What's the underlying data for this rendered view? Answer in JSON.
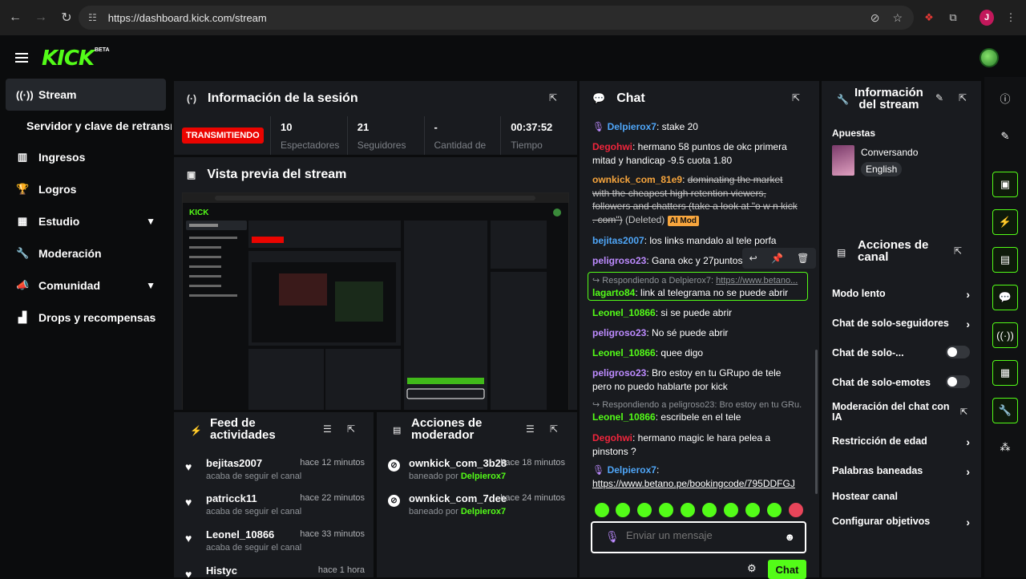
{
  "browser": {
    "url": "https://dashboard.kick.com/stream",
    "profile_initial": "J"
  },
  "app": {
    "logo": "KICK",
    "beta": "BETA"
  },
  "sidebar": {
    "items": [
      {
        "label": "Stream"
      },
      {
        "label": "Servidor y clave de retransmisión"
      },
      {
        "label": "Ingresos"
      },
      {
        "label": "Logros"
      },
      {
        "label": "Estudio"
      },
      {
        "label": "Moderación"
      },
      {
        "label": "Comunidad"
      },
      {
        "label": "Drops y recompensas"
      }
    ]
  },
  "session": {
    "title": "Información de la sesión",
    "live_badge": "TRANSMITIENDO",
    "stats": [
      {
        "value": "10",
        "label": "Espectadores"
      },
      {
        "value": "21",
        "label": "Seguidores"
      },
      {
        "value": "-",
        "label": "Cantidad de"
      },
      {
        "value": "00:37:52",
        "label": "Tiempo"
      }
    ]
  },
  "preview": {
    "title": "Vista previa del stream"
  },
  "feed": {
    "title_line1": "Feed de",
    "title_line2": "actividades",
    "items": [
      {
        "name": "bejitas2007",
        "time": "hace 12 minutos",
        "action": "acaba de seguir el canal"
      },
      {
        "name": "patricck11",
        "time": "hace 22 minutos",
        "action": "acaba de seguir el canal"
      },
      {
        "name": "Leonel_10866",
        "time": "hace 33 minutos",
        "action": "acaba de seguir el canal"
      },
      {
        "name": "Histyc",
        "time": "hace 1 hora",
        "action": ""
      }
    ]
  },
  "mod_actions": {
    "title_line1": "Acciones de",
    "title_line2": "moderador",
    "items": [
      {
        "name": "ownkick_com_3b28",
        "time": "hace 18 minutos",
        "prefix": "baneado por",
        "by": "Delpierox7"
      },
      {
        "name": "ownkick_com_7dee",
        "time": "hace 24 minutos",
        "prefix": "baneado por",
        "by": "Delpierox7"
      }
    ]
  },
  "chat": {
    "title": "Chat",
    "messages": [
      {
        "user": "Delpierox7",
        "text": "stake 20"
      },
      {
        "user": "Degohwi",
        "text": "hermano 58 puntos de okc primera mitad y handicap -9.5 cuota 1.80"
      },
      {
        "user": "ownkick_com_81e9",
        "text": "dominating the market with the cheapest high retention viewers, followers and chatters (take a look at \"o w n kick . com\")",
        "deleted": "(Deleted)",
        "badge": "AI Mod"
      },
      {
        "user": "bejitas2007",
        "text": "los links mandalo al tele porfa"
      },
      {
        "user": "peligroso23",
        "text": "Gana okc y 27puntos s"
      },
      {
        "reply_prefix": "Respondiendo a Delpierox7:",
        "reply_link": "https://www.betano...",
        "user": "lagarto84",
        "text": "link al telegrama no se puede abrir"
      },
      {
        "user": "Leonel_10866",
        "text": "si se puede abrir"
      },
      {
        "user": "peligroso23",
        "text": "No sé puede abrir"
      },
      {
        "user": "Leonel_10866",
        "text": "quee digo"
      },
      {
        "user": "peligroso23",
        "text": "Bro estoy en tu GRupo de tele pero no puedo hablarte por kick"
      },
      {
        "reply_prefix": "Respondiendo a peligroso23: Bro estoy en tu GRu...",
        "user": "Leonel_10866",
        "text": "escribele en el tele"
      },
      {
        "user": "Degohwi",
        "text": "hermano magic le hara pelea a pinstons ?"
      },
      {
        "user": "Delpierox7",
        "link": "https://www.betano.pe/bookingcode/795DDFGJ"
      }
    ],
    "input_placeholder": "Enviar un mensaje",
    "send_label": "Chat"
  },
  "stream_info": {
    "title_line1": "Información",
    "title_line2": "del stream",
    "category": "Apuestas",
    "stream_title": "Conversando",
    "language": "English"
  },
  "channel_actions": {
    "title_line1": "Acciones de",
    "title_line2": "canal",
    "items": [
      {
        "label": "Modo lento",
        "control": "arrow"
      },
      {
        "label": "Chat de solo-seguidores",
        "control": "arrow"
      },
      {
        "label": "Chat de solo-...",
        "control": "toggle"
      },
      {
        "label": "Chat de solo-emotes",
        "control": "toggle"
      },
      {
        "label": "Moderación del chat con IA",
        "control": "external"
      },
      {
        "label": "Restricción de edad",
        "control": "arrow"
      },
      {
        "label": "Palabras baneadas",
        "control": "arrow"
      },
      {
        "label": "Hostear canal",
        "control": "none"
      },
      {
        "label": "Configurar objetivos",
        "control": "arrow"
      }
    ]
  },
  "colors": {
    "brand_green": "#53fc18",
    "live_red": "#eb0400",
    "panel_bg": "#191b1f"
  }
}
